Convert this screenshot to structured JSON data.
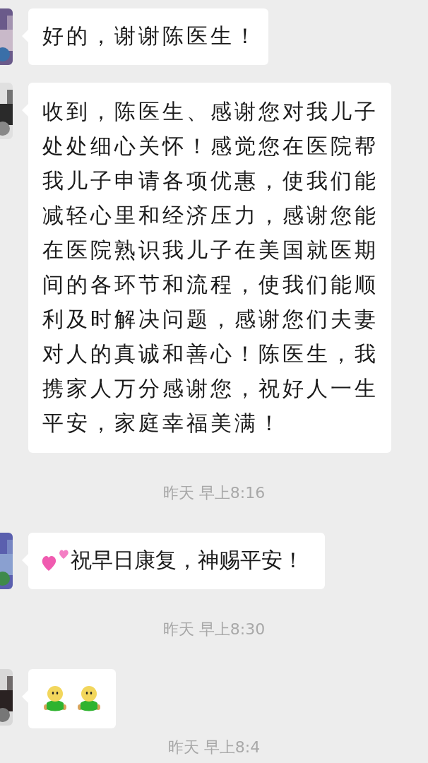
{
  "chat": [
    {
      "kind": "text_message",
      "text": "好的，谢谢陈医生！"
    },
    {
      "kind": "text_message",
      "text": "收到，陈医生、感谢您对我儿子处处细心关怀！感觉您在医院帮我儿子申请各项优惠，使我们能减轻心里和经济压力，感谢您能在医院熟识我儿子在美国就医期间的各环节和流程，使我们能顺利及时解决问题，感谢您们夫妻对人的真诚和善心！陈医生，我携家人万分感谢您，祝好人一生平安，家庭幸福美满！"
    },
    {
      "kind": "time",
      "text": "昨天 早上8:16"
    },
    {
      "kind": "hearts_message",
      "text": "祝早日康复，神赐平安！"
    },
    {
      "kind": "time",
      "text": "昨天 早上8:30"
    },
    {
      "kind": "figures_message"
    },
    {
      "kind": "time",
      "text": "昨天 早上8:4"
    }
  ]
}
